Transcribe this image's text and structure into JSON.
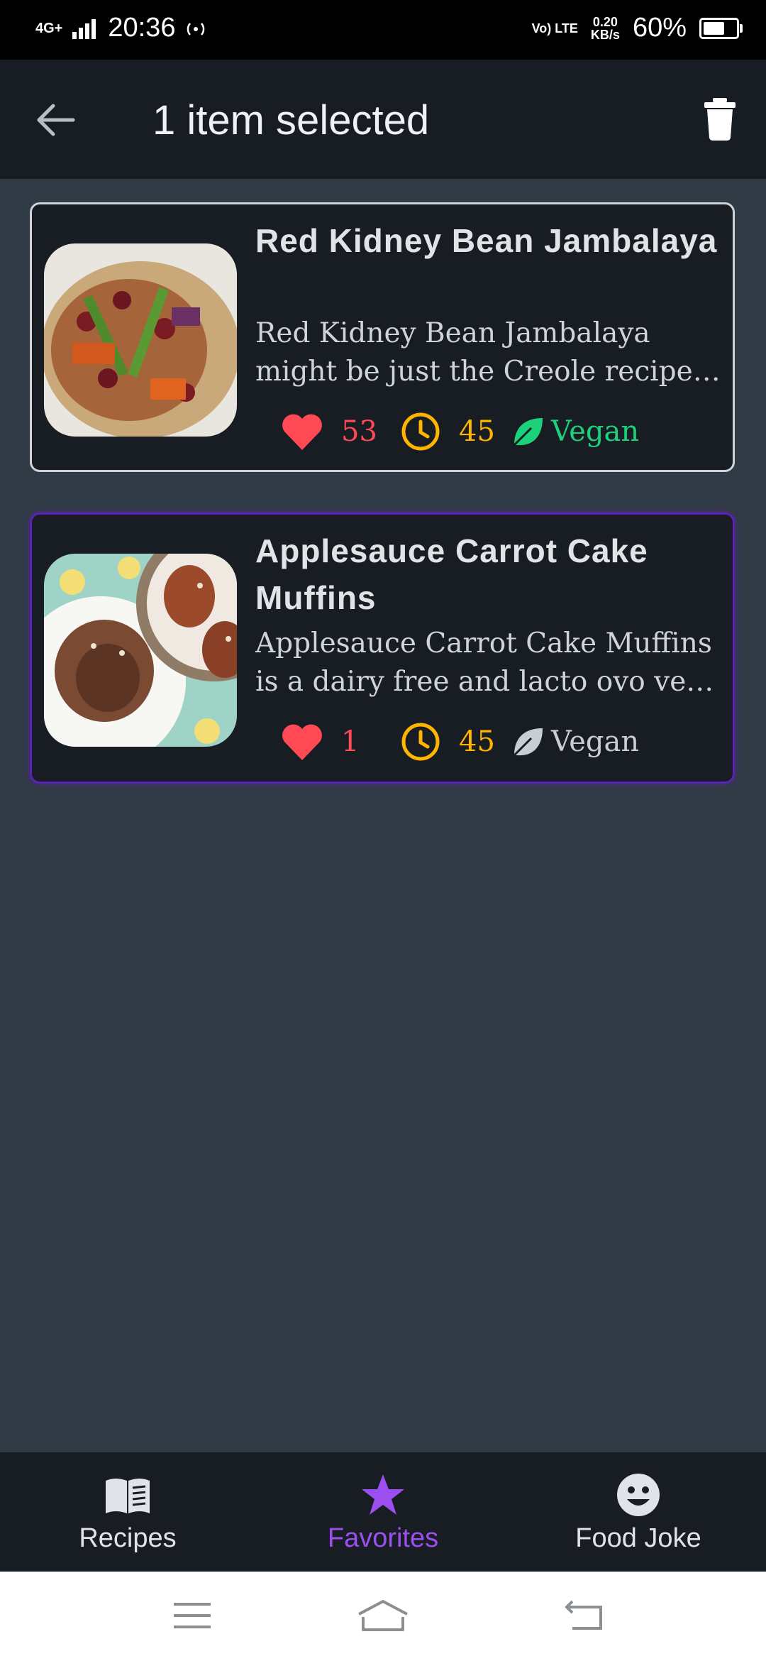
{
  "status": {
    "network": "4G+",
    "time": "20:36",
    "volte": "Vo) LTE",
    "speed_value": "0.20",
    "speed_unit": "KB/s",
    "battery": "60%"
  },
  "app_bar": {
    "title": "1 item selected",
    "back_icon": "arrow-left-icon",
    "delete_icon": "trash-icon"
  },
  "recipes": [
    {
      "title": "Red Kidney Bean Jambalaya",
      "description_line1": "Red Kidney Bean Jambalaya",
      "description_line2": "might be just the Creole recipe…",
      "likes": "53",
      "minutes": "45",
      "vegan_label": "Vegan",
      "vegan": true,
      "selected": false
    },
    {
      "title": "Applesauce Carrot Cake Muffins",
      "description_line1": "Applesauce Carrot Cake Muffins",
      "description_line2": "is a dairy free and lacto ovo ve…",
      "likes": "1",
      "minutes": "45",
      "vegan_label": "Vegan",
      "vegan": false,
      "selected": true
    }
  ],
  "bottom_nav": {
    "items": [
      {
        "label": "Recipes",
        "icon": "book-icon"
      },
      {
        "label": "Favorites",
        "icon": "star-icon",
        "active": true
      },
      {
        "label": "Food Joke",
        "icon": "smiley-icon"
      }
    ]
  },
  "colors": {
    "accent": "#9b4ff0",
    "likes": "#ff4a55",
    "time": "#ffb400",
    "vegan_active": "#1bd17a"
  }
}
